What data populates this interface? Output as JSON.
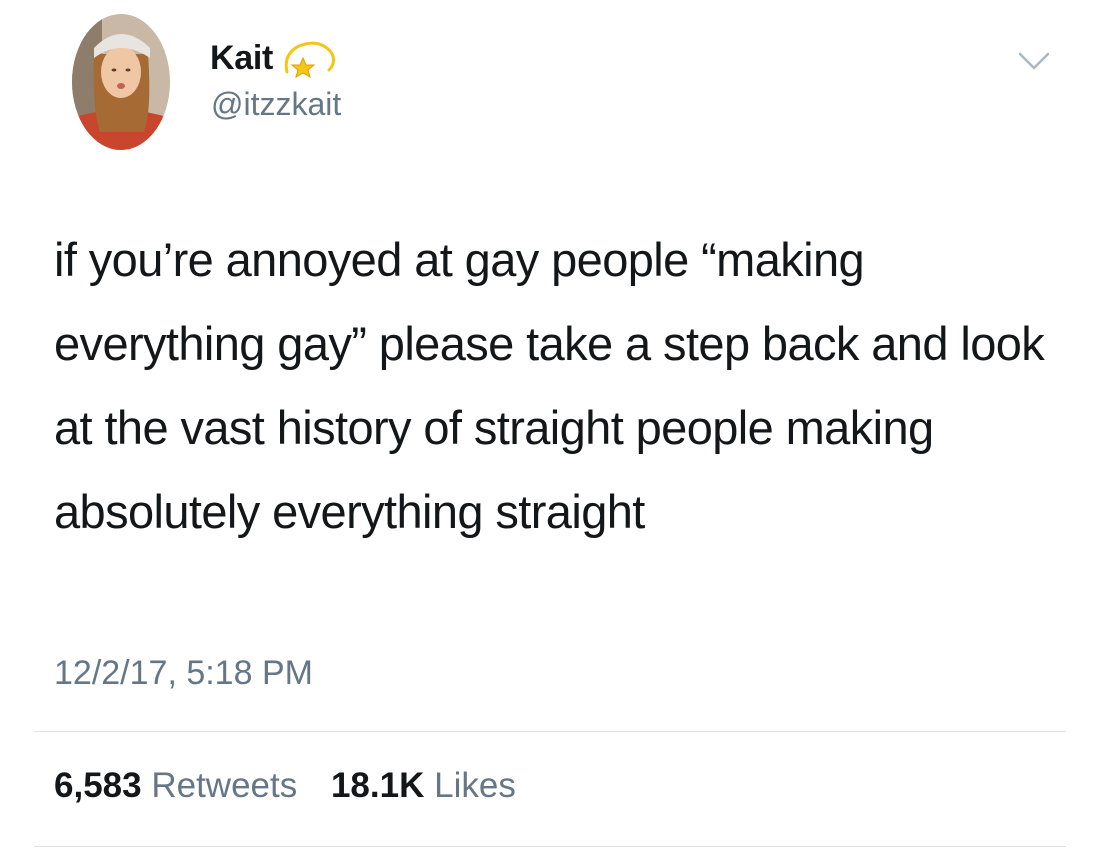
{
  "author": {
    "display_name": "Kait",
    "handle": "@itzzkait",
    "avatar_icon": "profile-photo",
    "badge_icon": "dizzy-star-emoji"
  },
  "tweet": {
    "text": "if you’re annoyed at gay people “making everything gay” please take a step back and look at the vast history of straight people making absolutely everything straight",
    "timestamp": "12/2/17, 5:18 PM"
  },
  "stats": {
    "retweets_count": "6,583",
    "retweets_label": "Retweets",
    "likes_count": "18.1K",
    "likes_label": "Likes"
  },
  "menu": {
    "icon": "chevron-down-icon"
  },
  "colors": {
    "text_primary": "#14171a",
    "text_secondary": "#657786",
    "divider": "#dfe3e6"
  }
}
